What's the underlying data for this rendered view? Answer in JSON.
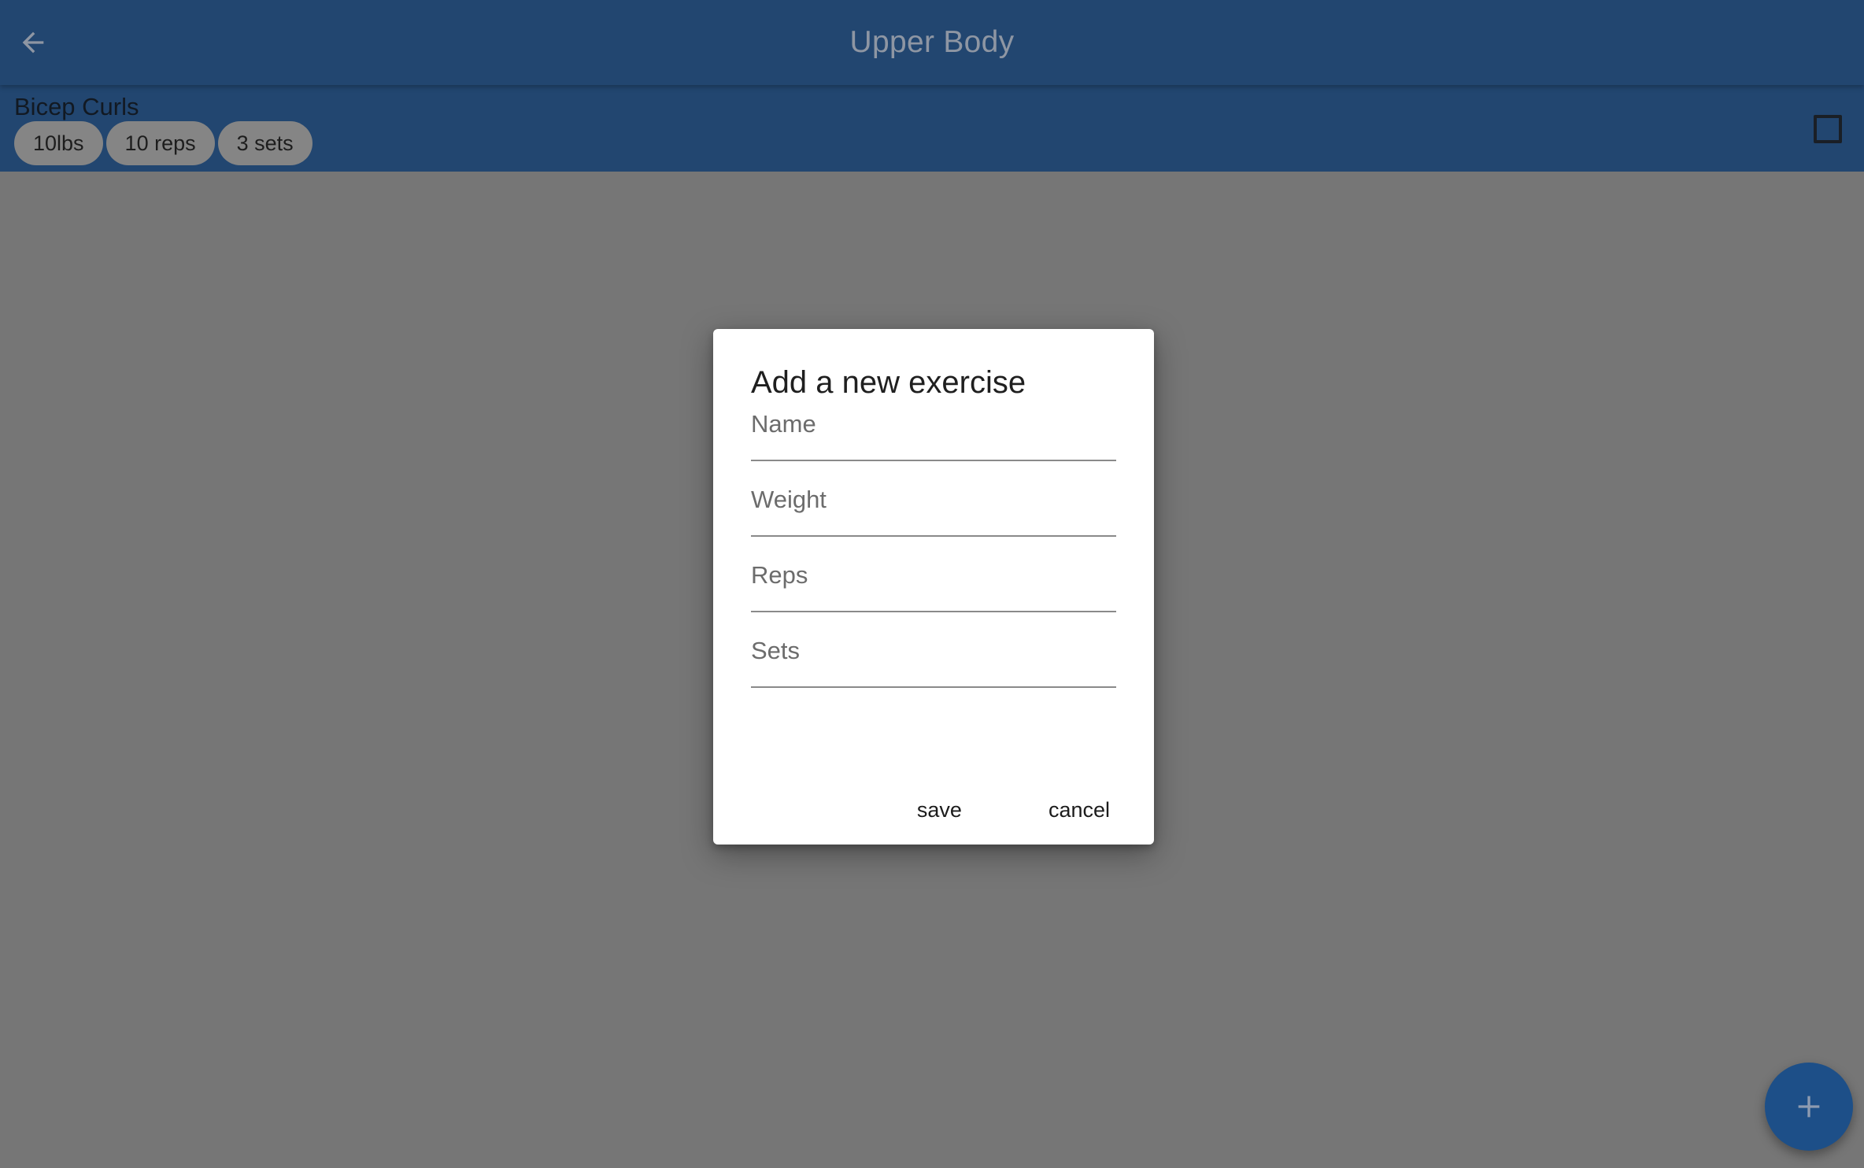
{
  "appbar": {
    "title": "Upper Body",
    "back_icon": "arrow-back-icon"
  },
  "exercise": {
    "name": "Bicep Curls",
    "chips": [
      "10lbs",
      "10 reps",
      "3 sets"
    ],
    "checked": false
  },
  "dialog": {
    "title": "Add a new exercise",
    "fields": {
      "name_placeholder": "Name",
      "weight_placeholder": "Weight",
      "reps_placeholder": "Reps",
      "sets_placeholder": "Sets"
    },
    "save_label": "save",
    "cancel_label": "cancel"
  },
  "fab": {
    "icon": "plus-icon"
  },
  "colors": {
    "primary": "#224670",
    "fab": "#1d4f88",
    "scrim": "#767676",
    "chip": "#858585"
  }
}
